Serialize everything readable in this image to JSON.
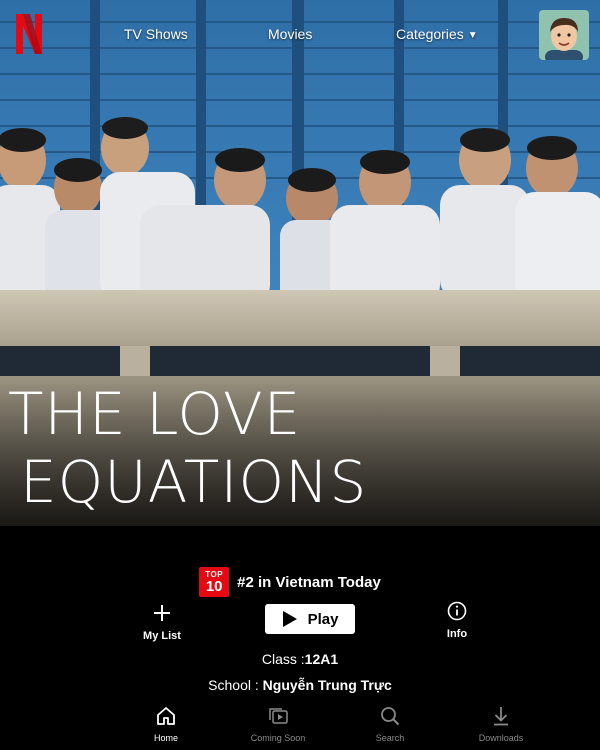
{
  "nav": {
    "items": [
      {
        "label": "TV Shows"
      },
      {
        "label": "Movies"
      },
      {
        "label": "Categories"
      }
    ]
  },
  "hero": {
    "title_line1": "THE LOVE",
    "title_line2": "EQUATIONS"
  },
  "badge": {
    "top_label": "TOP",
    "top_number": "10",
    "rank_text": "#2 in Vietnam Today",
    "color": "#e50914"
  },
  "actions": {
    "my_list": "My List",
    "play": "Play",
    "info": "Info"
  },
  "details": {
    "class_label": "Class :",
    "class_value": "12A1",
    "school_label": "School :",
    "school_value": "Nguyễn Trung Trực"
  },
  "tabs": [
    {
      "label": "Home",
      "icon": "home-icon",
      "active": true
    },
    {
      "label": "Coming Soon",
      "icon": "coming-soon-icon",
      "active": false
    },
    {
      "label": "Search",
      "icon": "search-icon",
      "active": false
    },
    {
      "label": "Downloads",
      "icon": "download-icon",
      "active": false
    }
  ],
  "colors": {
    "accent": "#e50914",
    "background": "#000000",
    "inactive_tab": "#8a8a8a"
  }
}
